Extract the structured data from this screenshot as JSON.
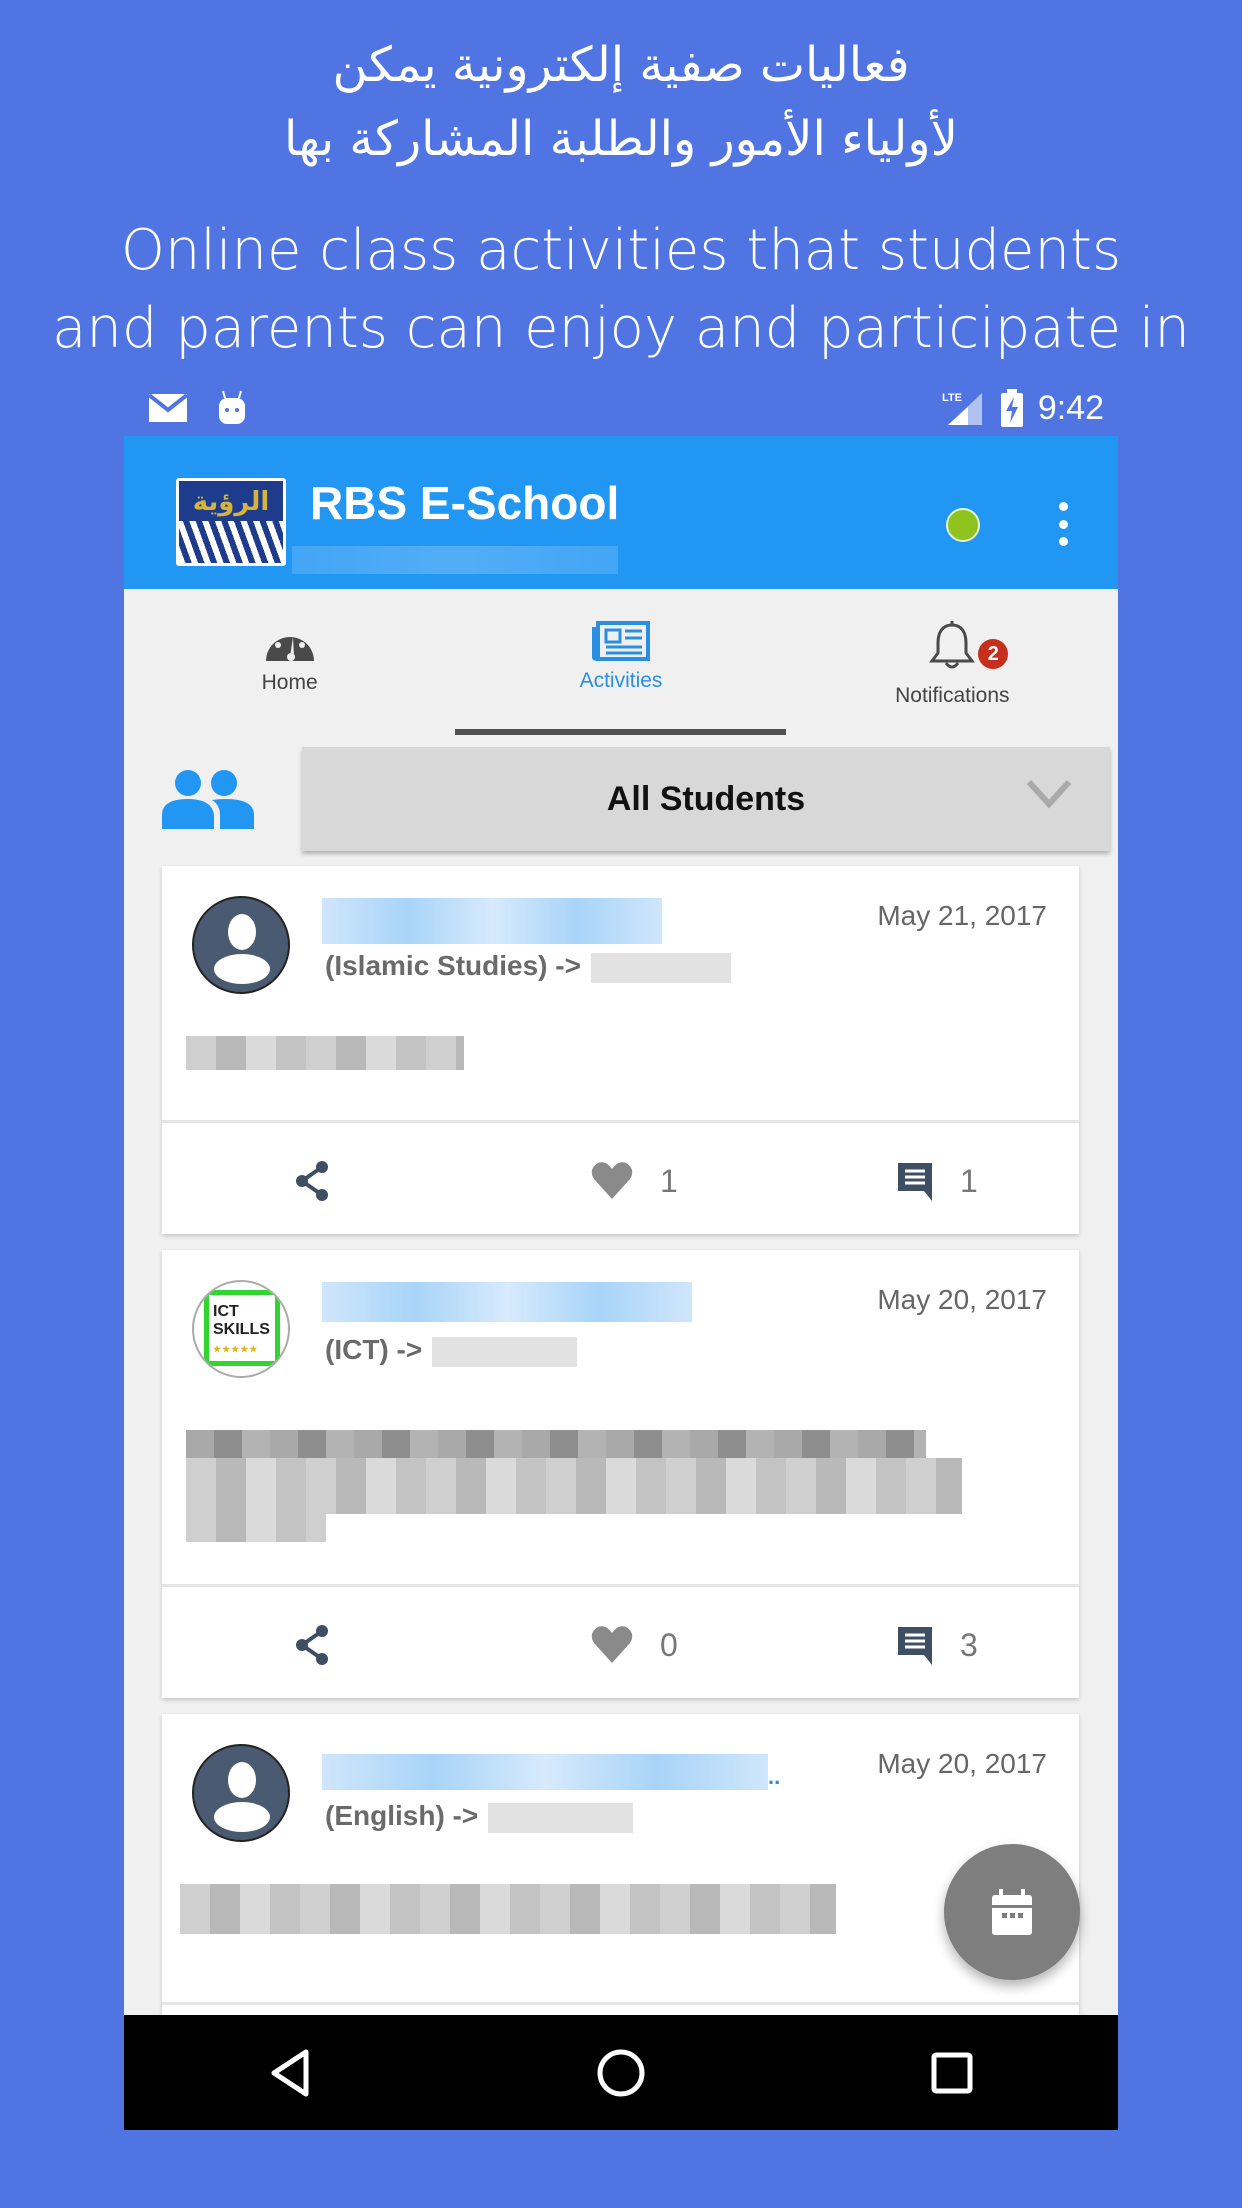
{
  "promo": {
    "arabic_line1": "فعاليات صفية إلكترونية يمكن",
    "arabic_line2": "لأولياء الأمور والطلبة المشاركة بها",
    "english_line1": "Online class activities that students",
    "english_line2": "and parents can enjoy and participate in"
  },
  "statusbar": {
    "icons": [
      "mail-icon",
      "android-icon",
      "lte-signal-icon",
      "battery-charging-icon"
    ],
    "network": "LTE",
    "time": "9:42"
  },
  "appbar": {
    "title": "RBS E-School",
    "logo_text": "الرؤية",
    "online_status_color": "#8fc31f",
    "accent": "#2196f3"
  },
  "tabs": [
    {
      "label": "Home",
      "icon": "dashboard-icon",
      "active": false
    },
    {
      "label": "Activities",
      "icon": "newspaper-icon",
      "active": true
    },
    {
      "label": "Notifications",
      "icon": "bell-icon",
      "active": false,
      "badge": "2"
    }
  ],
  "filter": {
    "selected": "All Students"
  },
  "feed": [
    {
      "subject": "(Islamic Studies)",
      "arrow": "->",
      "date": "May 21, 2017",
      "avatar": "default-user",
      "likes": "1",
      "comments": "1",
      "liked": false
    },
    {
      "subject": "(ICT)",
      "arrow": "->",
      "date": "May 20, 2017",
      "avatar": "ict-skills",
      "avatar_text_1": "ICT",
      "avatar_text_2": "SKILLS",
      "avatar_stars": "★★★★★",
      "likes": "0",
      "comments": "3",
      "liked": false
    },
    {
      "subject": "(English)",
      "arrow": "->",
      "date": "May 20, 2017",
      "avatar": "default-user",
      "title_suffix": "..",
      "likes": "",
      "comments": "",
      "liked": true
    }
  ],
  "fab": {
    "icon": "calendar-icon"
  },
  "navbar": {
    "buttons": [
      "back",
      "home",
      "recents"
    ]
  }
}
